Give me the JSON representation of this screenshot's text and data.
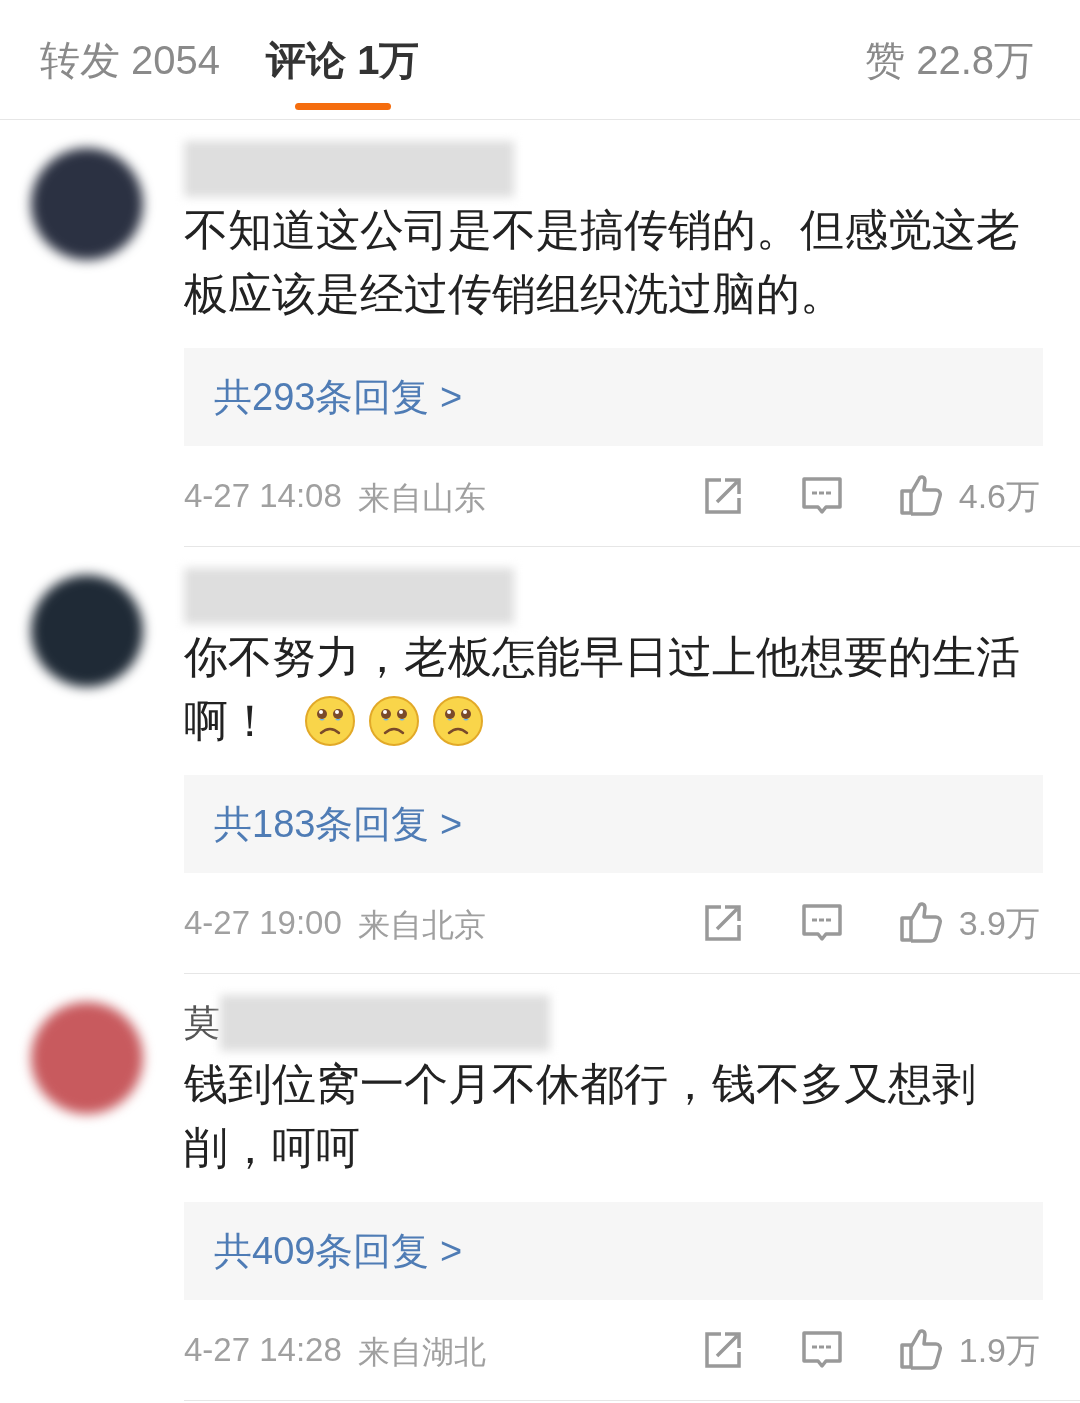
{
  "tabs": [
    {
      "label": "转发 2054",
      "selected": false
    },
    {
      "label": "评论 1万",
      "selected": true
    }
  ],
  "likes_tab": {
    "label": "赞 22.8万"
  },
  "comments": [
    {
      "color": "#2b3142",
      "text_lines": [
        "不知道这公司是不是搞传销的。但感觉这老",
        "板应该是经过传销组织洗过脑的。"
      ],
      "replies": "共293条回复 >",
      "time": "4-27 14:08",
      "location": "来自山东",
      "likes": "4.6万"
    },
    {
      "color": "#1f2a36",
      "text_lines": [
        "你不努力，老板怎能早日过上他想要的生活",
        "啊！"
      ],
      "emojis": [
        {
          "kind": "teary"
        },
        {
          "kind": "teary"
        },
        {
          "kind": "teary"
        }
      ],
      "replies": "共183条回复 >",
      "time": "4-27 19:00",
      "location": "来自北京",
      "likes": "3.9万"
    },
    {
      "color": "#c85a5e",
      "name_visible": "莫",
      "text_lines": [
        "钱到位窝一个月不休都行，钱不多又想剥",
        "削，呵呵"
      ],
      "replies": "共409条回复 >",
      "time": "4-27 14:28",
      "location": "来自湖北",
      "likes": "1.9万"
    }
  ]
}
